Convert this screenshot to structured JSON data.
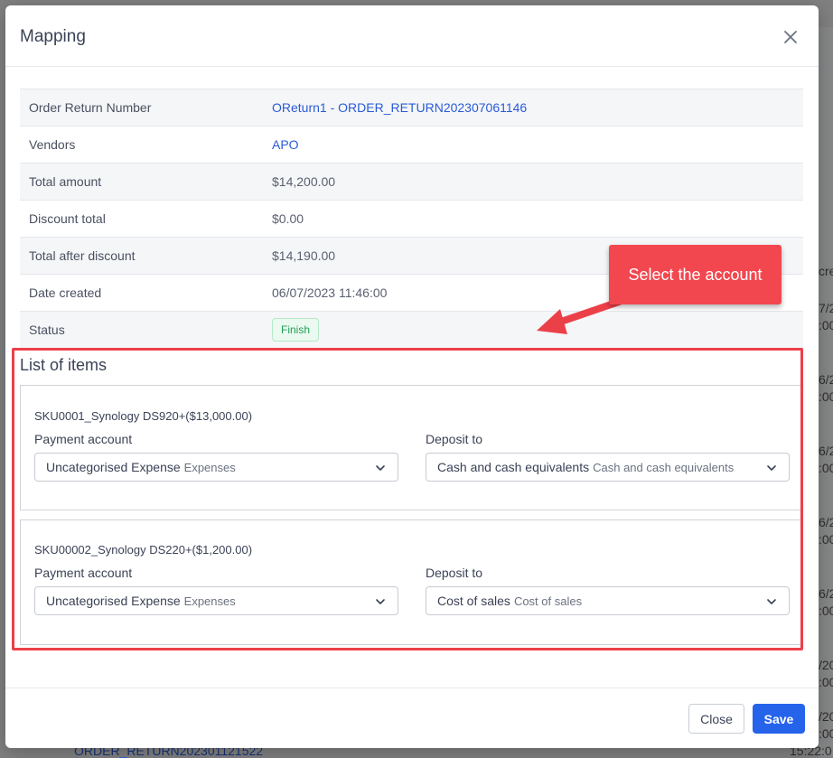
{
  "background": {
    "fragments": [
      "cre",
      "7/2",
      ":00",
      "6/2",
      ":00",
      "6/2",
      ":00",
      "6/2",
      ":00",
      "6/2",
      ":00",
      "/20",
      ":00",
      "/20",
      ":00"
    ],
    "link": "ORDER_RETURN202301121522",
    "time": "15:22:0"
  },
  "modal": {
    "title": "Mapping",
    "info": [
      {
        "label": "Order Return Number",
        "value": "OReturn1 - ORDER_RETURN202307061146",
        "link": true
      },
      {
        "label": "Vendors",
        "value": "APO",
        "link": true
      },
      {
        "label": "Total amount",
        "value": "$14,200.00"
      },
      {
        "label": "Discount total",
        "value": "$0.00"
      },
      {
        "label": "Total after discount",
        "value": "$14,190.00"
      },
      {
        "label": "Date created",
        "value": "06/07/2023 11:46:00"
      }
    ],
    "status_label": "Status",
    "status_value": "Finish",
    "items_title": "List of items",
    "items": [
      {
        "name": "SKU0001_Synology DS920+($13,000.00)",
        "payment_label": "Payment account",
        "payment_value": "Uncategorised Expense",
        "payment_sub": "Expenses",
        "deposit_label": "Deposit to",
        "deposit_value": "Cash and cash equivalents",
        "deposit_sub": "Cash and cash equivalents"
      },
      {
        "name": "SKU00002_Synology DS220+($1,200.00)",
        "payment_label": "Payment account",
        "payment_value": "Uncategorised Expense",
        "payment_sub": "Expenses",
        "deposit_label": "Deposit to",
        "deposit_value": "Cost of sales",
        "deposit_sub": "Cost of sales"
      }
    ],
    "footer": {
      "close_label": "Close",
      "save_label": "Save"
    }
  },
  "annotation": {
    "callout_text": "Select the account",
    "color": "#ec4049"
  },
  "colors": {
    "primary": "#2563eb",
    "link": "#2a5bd7",
    "status_green": "#1f9d55"
  }
}
